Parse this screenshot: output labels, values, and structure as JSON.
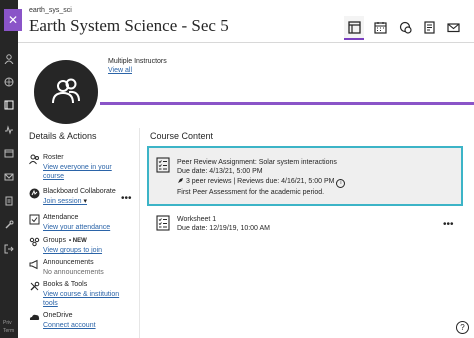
{
  "course": {
    "id": "earth_sys_sci",
    "title": "Earth System Science - Sec 5"
  },
  "rail": {
    "footer_line1": "Priv",
    "footer_line2": "Term"
  },
  "toolbar": {
    "items": [
      "outline-icon",
      "calendar-icon",
      "discussions-icon",
      "gradebook-icon",
      "messages-icon"
    ],
    "active": "outline-icon"
  },
  "banner": {
    "instructors_label": "Multiple Instructors",
    "view_all": "View all",
    "accent_color": "#8a54c8"
  },
  "details": {
    "heading": "Details & Actions",
    "items": [
      {
        "icon": "roster-icon",
        "title": "Roster",
        "sub": "View everyone in your course"
      },
      {
        "icon": "collaborate-icon",
        "title": "Blackboard Collaborate",
        "sub": "Join session"
      },
      {
        "icon": "attendance-icon",
        "title": "Attendance",
        "sub": "View your attendance"
      },
      {
        "icon": "groups-icon",
        "title": "Groups",
        "badge": "• NEW",
        "sub": "View groups to join"
      },
      {
        "icon": "announcements-icon",
        "title": "Announcements",
        "sub": "No announcements"
      },
      {
        "icon": "books-tools-icon",
        "title": "Books & Tools",
        "sub": "View course & institution tools"
      },
      {
        "icon": "onedrive-icon",
        "title": "OneDrive",
        "sub": "Connect account"
      }
    ]
  },
  "content": {
    "heading": "Course Content",
    "items": [
      {
        "title": "Peer Review Assignment: Solar system interactions",
        "due": "Due date: 4/13/21, 5:00 PM",
        "reviews": "3 peer reviews  |  Reviews due: 4/16/21, 5:00 PM",
        "description": "First Peer Assessment for the academic period.",
        "highlight_color": "#3cb4c7"
      },
      {
        "title": "Worksheet 1",
        "due": "Due date: 12/19/19, 10:00 AM"
      }
    ]
  },
  "more_glyph": "•••",
  "help_glyph": "?"
}
